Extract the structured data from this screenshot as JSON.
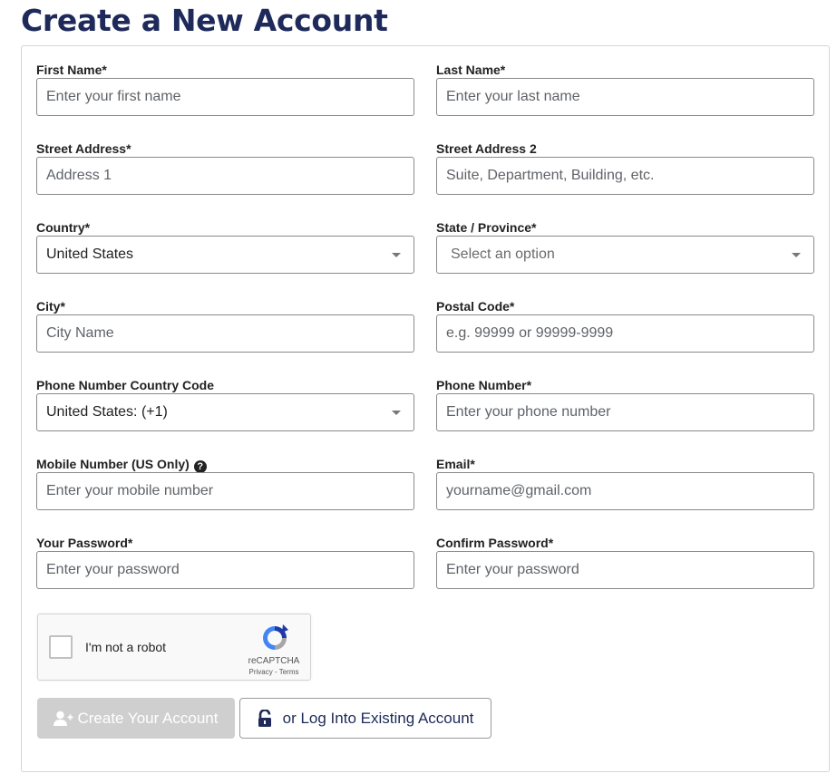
{
  "page": {
    "title": "Create a New Account"
  },
  "fields": {
    "first_name": {
      "label": "First Name*",
      "placeholder": "Enter your first name"
    },
    "last_name": {
      "label": "Last Name*",
      "placeholder": "Enter your last name"
    },
    "street_address": {
      "label": "Street Address*",
      "placeholder": "Address 1"
    },
    "street_address_2": {
      "label": "Street Address 2",
      "placeholder": "Suite, Department, Building, etc."
    },
    "country": {
      "label": "Country*",
      "value": "United States"
    },
    "state": {
      "label": "State / Province*",
      "placeholder": "Select an option"
    },
    "city": {
      "label": "City*",
      "placeholder": "City Name"
    },
    "postal_code": {
      "label": "Postal Code*",
      "placeholder": "e.g. 99999 or 99999-9999"
    },
    "phone_country_code": {
      "label": "Phone Number Country Code",
      "value": "United States: (+1)"
    },
    "phone_number": {
      "label": "Phone Number*",
      "placeholder": "Enter your phone number"
    },
    "mobile_number": {
      "label": "Mobile Number (US Only)",
      "help_icon": "question-circle-icon",
      "placeholder": "Enter your mobile number"
    },
    "email": {
      "label": "Email*",
      "placeholder": "yourname@gmail.com"
    },
    "password": {
      "label": "Your Password*",
      "placeholder": "Enter your password"
    },
    "confirm_password": {
      "label": "Confirm Password*",
      "placeholder": "Enter your password"
    }
  },
  "captcha": {
    "label": "I'm not a robot",
    "brand": "reCAPTCHA",
    "links": "Privacy - Terms",
    "icon": "recaptcha-logo-icon"
  },
  "actions": {
    "create_label": "Create Your Account",
    "create_icon": "user-plus-icon",
    "login_label": "or Log Into Existing Account",
    "login_icon": "unlock-icon"
  },
  "colors": {
    "title": "#1e2a5a",
    "button_disabled": "#cfcfcf",
    "login_text": "#1e2a5a",
    "input_border": "#8a8a8a"
  }
}
